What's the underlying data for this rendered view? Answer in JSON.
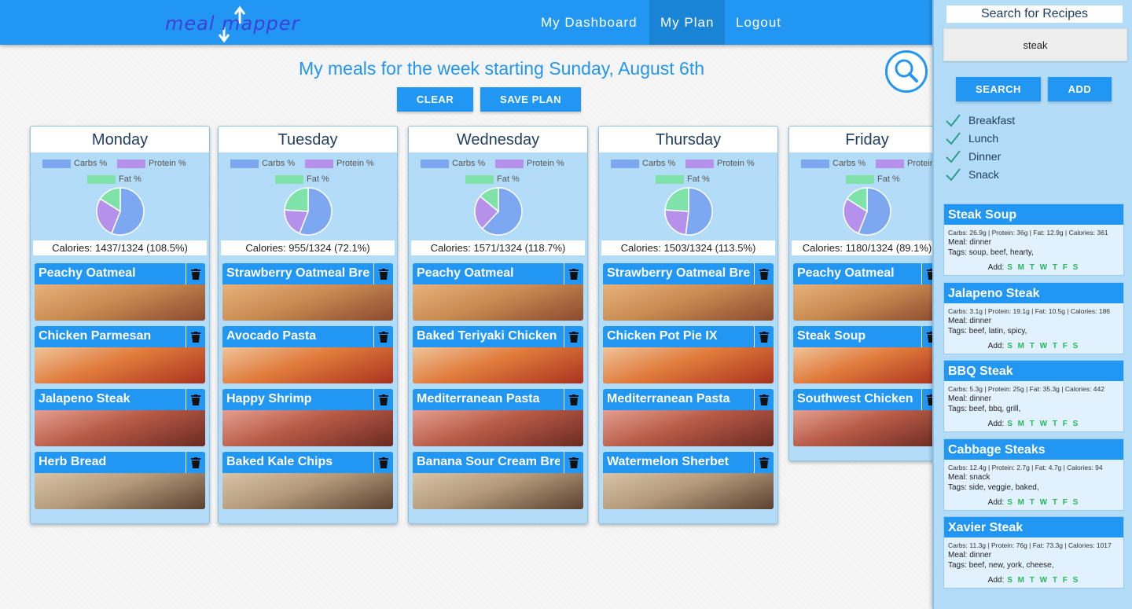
{
  "header": {
    "logo_text": "meal mapper",
    "nav": [
      "My Dashboard",
      "My Plan",
      "Logout"
    ]
  },
  "page": {
    "title": "My meals for the week starting Sunday, August 6th",
    "clear_label": "CLEAR",
    "save_label": "SAVE PLAN"
  },
  "legend": {
    "carbs": "Carbs %",
    "protein": "Protein %",
    "fat": "Fat %"
  },
  "colors": {
    "carbs": "#7da7f0",
    "protein": "#b591ec",
    "fat": "#7fe2a8",
    "primary": "#2196f3"
  },
  "days": [
    {
      "name": "Monday",
      "calories": "Calories: 1437/1324 (108.5%)",
      "macros": {
        "carbs": 56,
        "protein": 28,
        "fat": 16
      },
      "meals": [
        "Peachy Oatmeal",
        "Chicken Parmesan",
        "Jalapeno Steak",
        "Herb Bread"
      ]
    },
    {
      "name": "Tuesday",
      "calories": "Calories: 955/1324 (72.1%)",
      "macros": {
        "carbs": 56,
        "protein": 20,
        "fat": 24
      },
      "meals": [
        "Strawberry Oatmeal Breakfast",
        "Avocado Pasta",
        "Happy Shrimp",
        "Baked Kale Chips"
      ]
    },
    {
      "name": "Wednesday",
      "calories": "Calories: 1571/1324 (118.7%)",
      "macros": {
        "carbs": 62,
        "protein": 24,
        "fat": 14
      },
      "meals": [
        "Peachy Oatmeal",
        "Baked Teriyaki Chicken",
        "Mediterranean Pasta",
        "Banana Sour Cream Bread"
      ]
    },
    {
      "name": "Thursday",
      "calories": "Calories: 1503/1324 (113.5%)",
      "macros": {
        "carbs": 52,
        "protein": 24,
        "fat": 24
      },
      "meals": [
        "Strawberry Oatmeal Breakfast",
        "Chicken Pot Pie IX",
        "Mediterranean Pasta",
        "Watermelon Sherbet"
      ]
    },
    {
      "name": "Friday",
      "calories": "Calories: 1180/1324 (89.1%)",
      "macros": {
        "carbs": 56,
        "protein": 28,
        "fat": 16
      },
      "meals": [
        "Peachy Oatmeal",
        "Steak Soup",
        "Southwest Chicken Salad"
      ]
    }
  ],
  "sidebar": {
    "title": "Search for Recipes",
    "search_value": "steak",
    "search_label": "SEARCH",
    "add_label": "ADD",
    "filters": [
      "Breakfast",
      "Lunch",
      "Dinner",
      "Snack"
    ],
    "add_prefix": "Add:",
    "week_days": "S M T W T F S",
    "results": [
      {
        "name": "Steak Soup",
        "macros": "Carbs: 26.9g | Protein: 36g | Fat: 12.9g | Calories: 361",
        "meal": "Meal: dinner",
        "tags": "Tags: soup, beef, hearty,"
      },
      {
        "name": "Jalapeno Steak",
        "macros": "Carbs: 3.1g | Protein: 19.1g | Fat: 10.5g | Calories: 186",
        "meal": "Meal: dinner",
        "tags": "Tags: beef, latin, spicy,"
      },
      {
        "name": "BBQ Steak",
        "macros": "Carbs: 5.3g | Protein: 25g | Fat: 35.3g | Calories: 442",
        "meal": "Meal: dinner",
        "tags": "Tags: beef, bbq, grill,"
      },
      {
        "name": "Cabbage Steaks",
        "macros": "Carbs: 12.4g | Protein: 2.7g | Fat: 4.7g | Calories: 94",
        "meal": "Meal: snack",
        "tags": "Tags: side, veggie, baked,"
      },
      {
        "name": "Xavier Steak",
        "macros": "Carbs: 11.3g | Protein: 76g | Fat: 73.3g | Calories: 1017",
        "meal": "Meal: dinner",
        "tags": "Tags: beef, new, york, cheese,"
      }
    ]
  }
}
